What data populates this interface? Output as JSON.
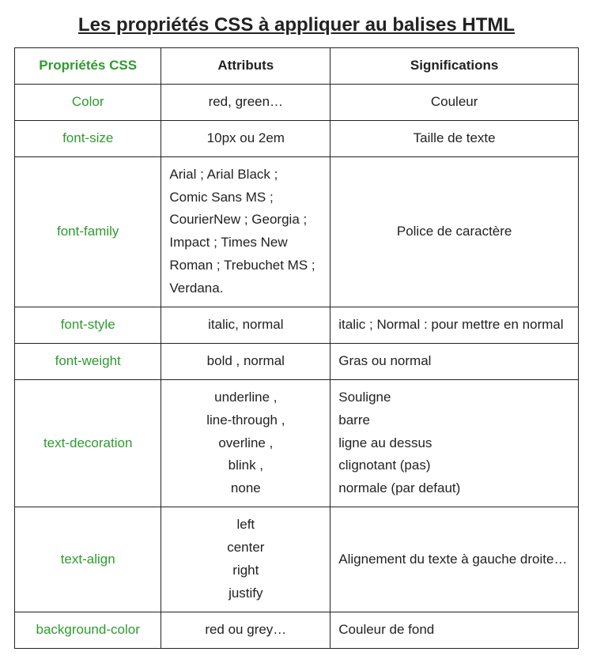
{
  "title": "Les propriétés CSS à appliquer au balises HTML",
  "headers": {
    "prop": "Propriétés CSS",
    "attr": "Attributs",
    "sig": "Significations"
  },
  "rows": [
    {
      "prop": "Color",
      "attr": "red, green…",
      "sig": "Couleur",
      "attr_align": "center",
      "sig_align": "center"
    },
    {
      "prop": "font-size",
      "attr": "10px ou 2em",
      "sig": "Taille de texte",
      "attr_align": "center",
      "sig_align": "center"
    },
    {
      "prop": "font-family",
      "attr": "Arial ; Arial Black ;\nComic Sans MS ;\nCourierNew ; Georgia ;\nImpact ; Times New\nRoman ;  Trebuchet MS ;\nVerdana.",
      "sig": "Police de caractère",
      "attr_align": "left",
      "sig_align": "center"
    },
    {
      "prop": "font-style",
      "attr": "italic, normal",
      "sig": "italic ; Normal : pour mettre en normal",
      "attr_align": "center",
      "sig_align": "left"
    },
    {
      "prop": "font-weight",
      "attr": "bold , normal",
      "sig": "Gras ou normal",
      "attr_align": "center",
      "sig_align": "left"
    },
    {
      "prop": "text-decoration",
      "attr": "underline ,\nline-through ,\noverline ,\nblink ,\nnone",
      "sig": "Souligne\nbarre\nligne au dessus\nclignotant (pas)\nnormale (par defaut)",
      "attr_align": "center",
      "sig_align": "left"
    },
    {
      "prop": "text-align",
      "attr": "left\ncenter\nright\njustify",
      "sig": "Alignement du texte à gauche droite…",
      "attr_align": "center",
      "sig_align": "left"
    },
    {
      "prop": "background-color",
      "attr": "red ou grey…",
      "sig": "Couleur de fond",
      "attr_align": "center",
      "sig_align": "left"
    }
  ],
  "chart_data": {
    "type": "table",
    "title": "Les propriétés CSS à appliquer au balises HTML",
    "columns": [
      "Propriétés CSS",
      "Attributs",
      "Significations"
    ],
    "rows": [
      [
        "Color",
        "red, green…",
        "Couleur"
      ],
      [
        "font-size",
        "10px ou 2em",
        "Taille de texte"
      ],
      [
        "font-family",
        "Arial ; Arial Black ; Comic Sans MS ; CourierNew ; Georgia ; Impact ; Times New Roman ; Trebuchet MS ; Verdana.",
        "Police de caractère"
      ],
      [
        "font-style",
        "italic, normal",
        "italic ; Normal : pour mettre en normal"
      ],
      [
        "font-weight",
        "bold , normal",
        "Gras ou normal"
      ],
      [
        "text-decoration",
        "underline , line-through , overline , blink , none",
        "Souligne ; barre ; ligne au dessus ; clignotant (pas) ; normale (par defaut)"
      ],
      [
        "text-align",
        "left center right justify",
        "Alignement du texte à gauche droite…"
      ],
      [
        "background-color",
        "red ou grey…",
        "Couleur de fond"
      ]
    ]
  }
}
